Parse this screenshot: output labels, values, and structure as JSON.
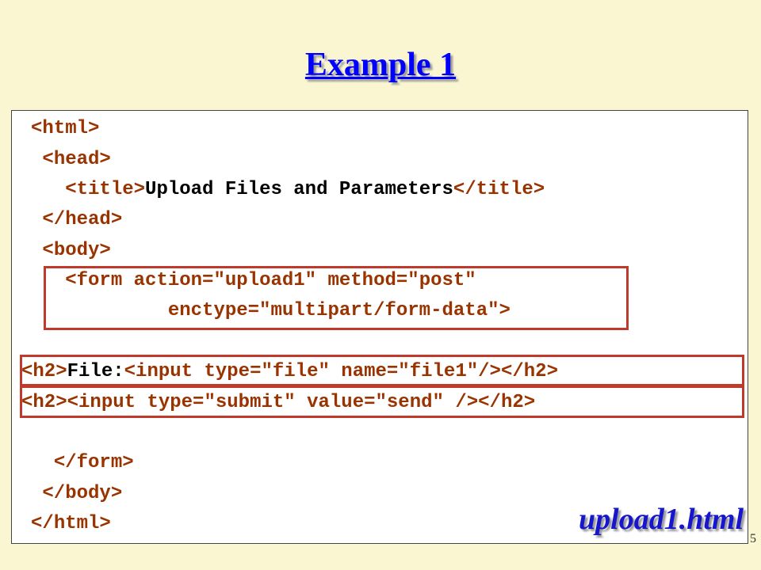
{
  "slide": {
    "title": "Example 1",
    "filename": "upload1.html",
    "page_number": "5"
  },
  "code": {
    "l1": {
      "open": "<",
      "tag": "html",
      "close": ">"
    },
    "l2": {
      "open": "<",
      "tag": "head",
      "close": ">"
    },
    "l3": {
      "open": "<",
      "tag": "title",
      "close": ">",
      "text": "Upload Files and Parameters",
      "end_open": "</",
      "end_tag": "title",
      "end_close": ">"
    },
    "l4": {
      "open": "</",
      "tag": "head",
      "close": ">"
    },
    "l5": {
      "open": "<",
      "tag": "body",
      "close": ">"
    },
    "l6": {
      "open": "<",
      "tag": "form",
      "attrs": " action=\"upload1\" method=\"post\""
    },
    "l7": {
      "attrs": "enctype=\"multipart/form-data\"",
      "close": ">"
    },
    "l8": {
      "open": "<",
      "tag": "h2",
      "close": ">",
      "text": "File:",
      "inner_open": "<",
      "inner_tag": "input",
      "inner_attrs": " type=\"file\" name=\"file1\"",
      "inner_close": "/>",
      "end_open": "</",
      "end_tag": "h2",
      "end_close": ">"
    },
    "l9": {
      "open": "<",
      "tag": "h2",
      "close": ">",
      "inner_open": "<",
      "inner_tag": "input",
      "inner_attrs": " type=\"submit\" value=\"send\" ",
      "inner_close": "/>",
      "end_open": "</",
      "end_tag": "h2",
      "end_close": ">"
    },
    "l10": {
      "open": "</",
      "tag": "form",
      "close": ">"
    },
    "l11": {
      "open": "</",
      "tag": "body",
      "close": ">"
    },
    "l12": {
      "open": "</",
      "tag": "html",
      "close": ">"
    }
  }
}
